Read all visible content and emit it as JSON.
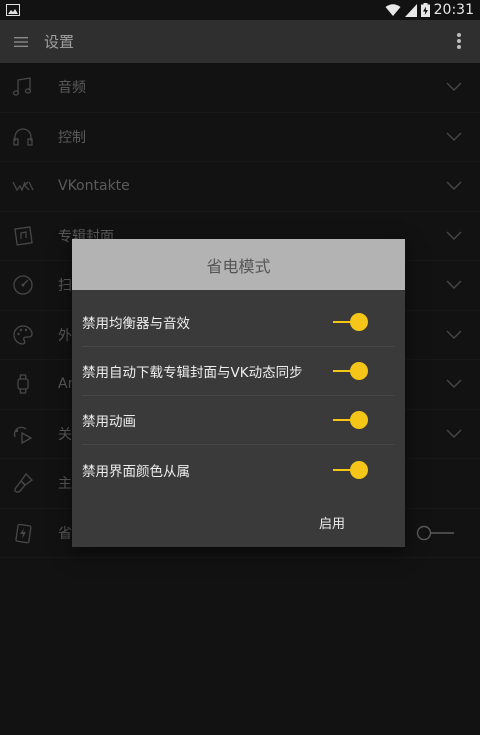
{
  "status_bar": {
    "time": "20:31",
    "icons": [
      "image-icon",
      "wifi-icon",
      "signal-icon",
      "battery-charging-icon"
    ]
  },
  "app_bar": {
    "title": "设置",
    "icons": [
      "menu-icon",
      "overflow-icon"
    ]
  },
  "settings": {
    "items": [
      {
        "label": "音频",
        "icon": "music-note-icon"
      },
      {
        "label": "控制",
        "icon": "headphones-icon"
      },
      {
        "label": "VKontakte",
        "icon": "vk-icon"
      },
      {
        "label": "专辑封面",
        "icon": "album-art-icon"
      },
      {
        "label": "扫",
        "icon": "scan-icon"
      },
      {
        "label": "外",
        "icon": "palette-icon"
      },
      {
        "label": "An",
        "icon": "watch-icon"
      },
      {
        "label": "关",
        "icon": "about-icon"
      },
      {
        "label": "主",
        "icon": "brush-icon"
      },
      {
        "label": "省",
        "icon": "battery-saver-icon"
      }
    ]
  },
  "dialog": {
    "title": "省电模式",
    "options": [
      {
        "label": "禁用均衡器与音效",
        "enabled": true
      },
      {
        "label": "禁用自动下载专辑封面与VK动态同步",
        "enabled": true
      },
      {
        "label": "禁用动画",
        "enabled": true
      },
      {
        "label": "禁用界面颜色从属",
        "enabled": true
      }
    ],
    "enable_button": "启用"
  },
  "colors": {
    "accent": "#f5c518",
    "background": "#1c1c1c",
    "dialog_bg": "#3a3a3a",
    "dialog_header": "#b3b3b3"
  }
}
